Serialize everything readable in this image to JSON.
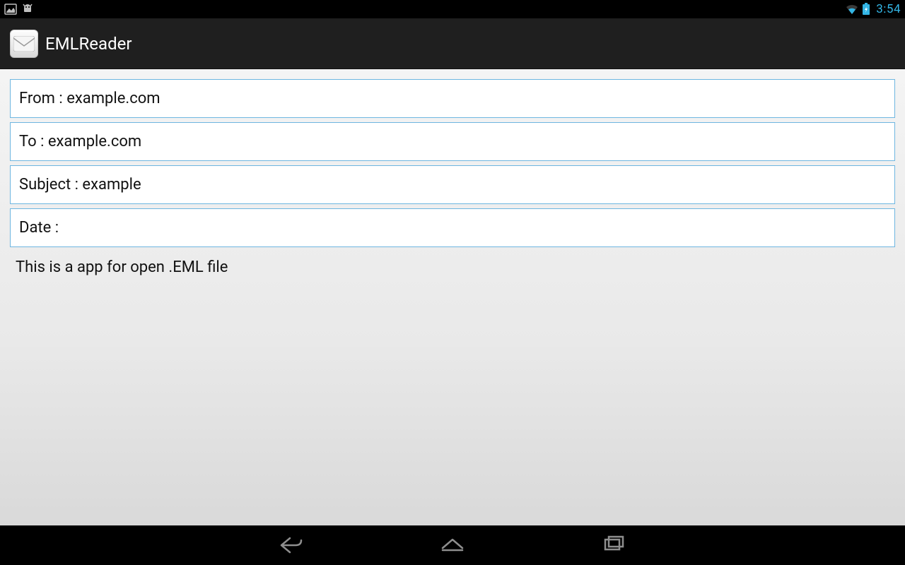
{
  "status": {
    "clock": "3:54"
  },
  "app": {
    "title": "EMLReader"
  },
  "fields": {
    "from": "From : example.com",
    "to": "To : example.com",
    "subject": "Subject : example",
    "date": "Date :"
  },
  "body": "This is a app for open .EML file"
}
